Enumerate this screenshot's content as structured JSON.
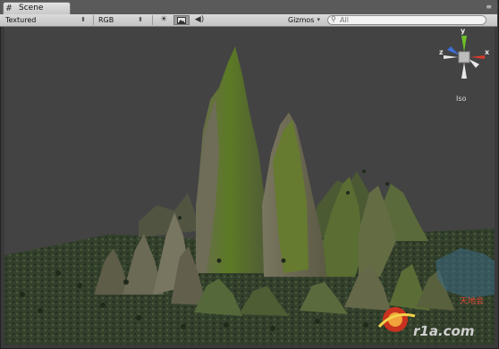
{
  "window": {
    "tab_title": "Scene",
    "tab_icon": "scene-grid-icon",
    "tab_menu_icon": "tab-menu-icon"
  },
  "toolbar": {
    "render_mode": "Textured",
    "channel_mode": "RGB",
    "lighting_icon": "sun-icon",
    "image_icon": "image-icon",
    "audio_icon": "speaker-icon",
    "gizmos_label": "Gizmos",
    "search_placeholder": "All"
  },
  "gizmo": {
    "x": "x",
    "y": "y",
    "z": "z",
    "projection": "Iso"
  },
  "watermark": {
    "text_cn": "天地会",
    "text_site": "r1a.com"
  },
  "colors": {
    "background": "#434343",
    "terrain_green": "#5f7a2a",
    "terrain_rock": "#6a6a55",
    "gizmo_x": "#d93a2a",
    "gizmo_y": "#6cbf2a",
    "gizmo_z": "#3b6fd4"
  }
}
